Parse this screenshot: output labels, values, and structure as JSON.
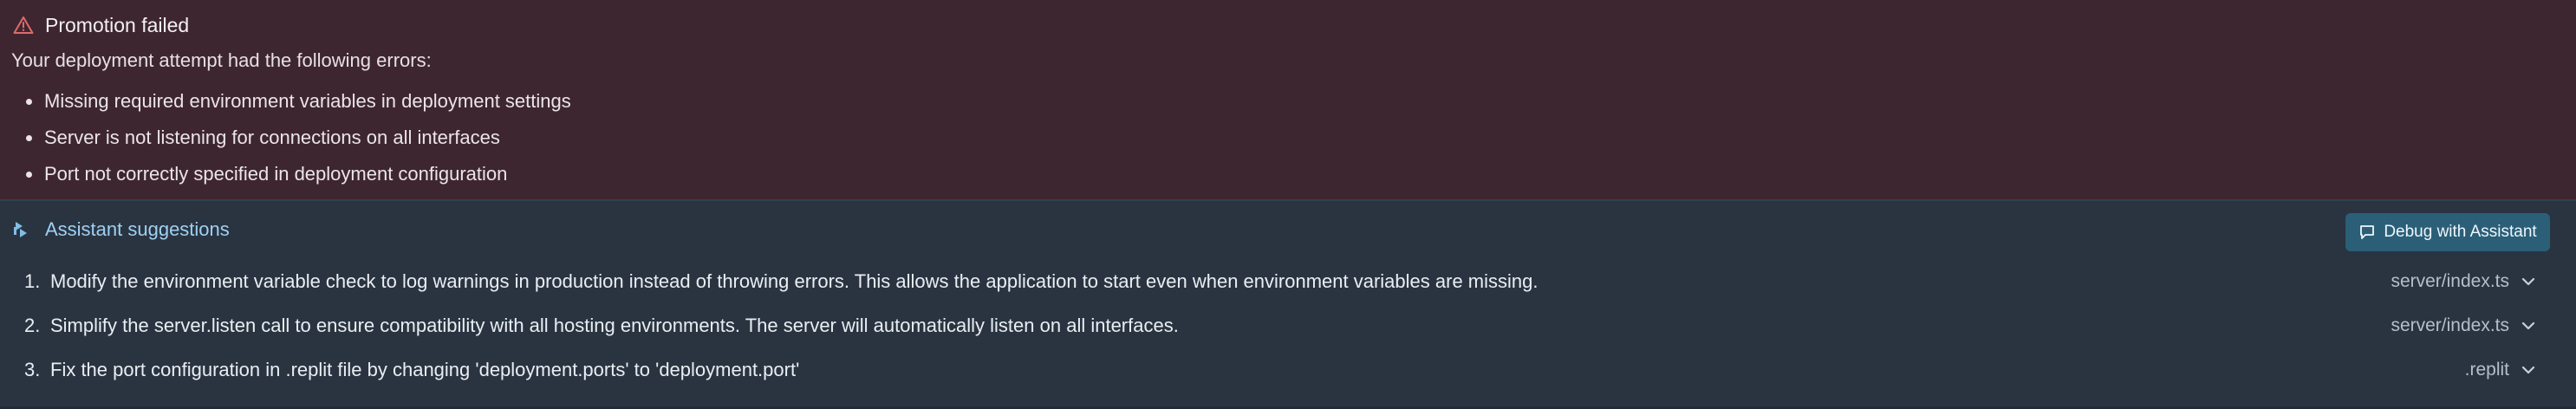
{
  "error": {
    "title": "Promotion failed",
    "intro": "Your deployment attempt had the following errors:",
    "items": [
      "Missing required environment variables in deployment settings",
      "Server is not listening for connections on all interfaces",
      "Port not correctly specified in deployment configuration"
    ],
    "icon": "warning-triangle-icon"
  },
  "assistant": {
    "title": "Assistant suggestions",
    "icon": "assistant-icon",
    "debug_button_label": "Debug with Assistant",
    "debug_button_icon": "chat-icon",
    "suggestions": [
      {
        "number": "1.",
        "text": "Modify the environment variable check to log warnings in production instead of throwing errors. This allows the application to start even when environment variables are missing.",
        "file": "server/index.ts"
      },
      {
        "number": "2.",
        "text": "Simplify the server.listen call to ensure compatibility with all hosting environments. The server will automatically listen on all interfaces.",
        "file": "server/index.ts"
      },
      {
        "number": "3.",
        "text": "Fix the port configuration in .replit file by changing 'deployment.ports' to 'deployment.port'",
        "file": ".replit"
      }
    ]
  },
  "colors": {
    "error_bg": "#3e2630",
    "panel_bg": "#2a3441",
    "accent_text": "#9fd0f2",
    "button_bg": "#2b5f78",
    "warning": "#e06a6a"
  }
}
